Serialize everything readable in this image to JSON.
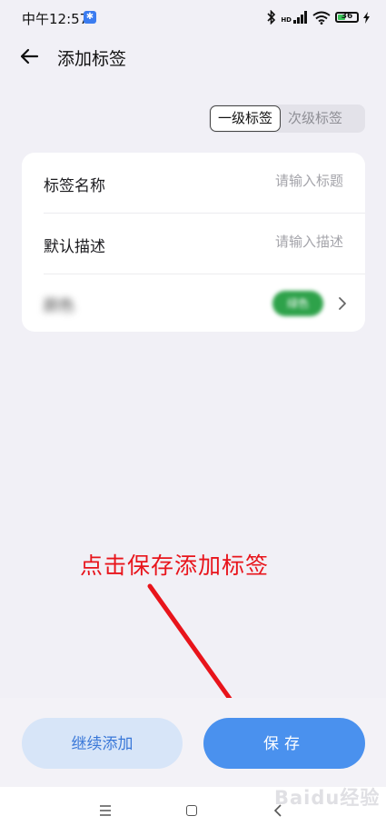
{
  "status_bar": {
    "time": "中午12:57",
    "bluetooth_badge": "✱",
    "signal_label": "HD",
    "battery_level": "36"
  },
  "header": {
    "title": "添加标签"
  },
  "tag_level": {
    "options": [
      "一级标签",
      "次级标签"
    ],
    "selected": "一级标签"
  },
  "form": {
    "name_label": "标签名称",
    "name_placeholder": "请输入标题",
    "desc_label": "默认描述",
    "desc_placeholder": "请输入描述",
    "color_label": "颜色",
    "color_value": "绿色",
    "color_hex": "#2ea24a"
  },
  "annotation": {
    "text": "点击保存添加标签",
    "color": "#e8141b"
  },
  "actions": {
    "continue_label": "继续添加",
    "save_label": "保存"
  },
  "watermark": {
    "text": "Baidu经验"
  },
  "colors": {
    "accent": "#4a91ee",
    "accent_light": "#d7e5f8",
    "background": "#f1f0f6"
  }
}
